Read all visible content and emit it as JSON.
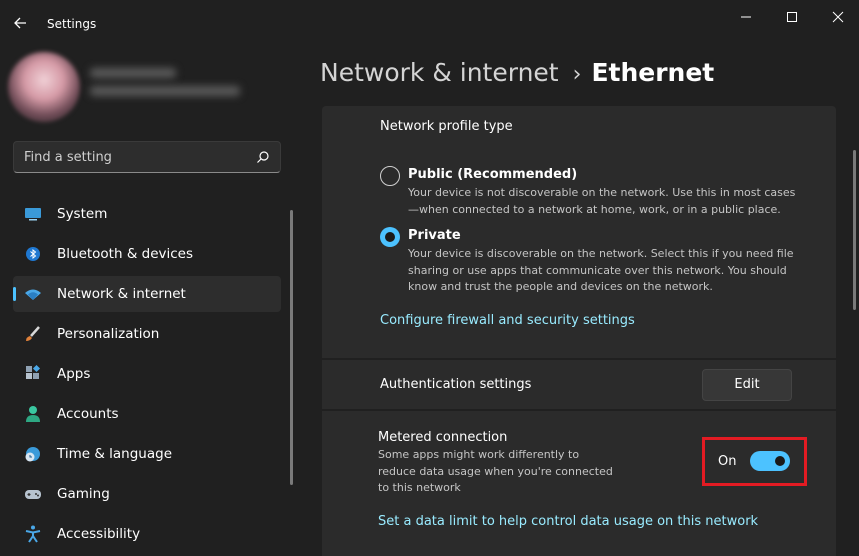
{
  "window": {
    "title": "Settings",
    "controls": [
      "minimize-icon",
      "maximize-icon",
      "close-icon"
    ]
  },
  "search": {
    "placeholder": "Find a setting"
  },
  "sidebar": {
    "items": [
      {
        "label": "System",
        "icon": "monitor-icon",
        "active": false
      },
      {
        "label": "Bluetooth & devices",
        "icon": "bluetooth-icon",
        "active": false
      },
      {
        "label": "Network & internet",
        "icon": "wifi-icon",
        "active": true
      },
      {
        "label": "Personalization",
        "icon": "brush-icon",
        "active": false
      },
      {
        "label": "Apps",
        "icon": "apps-icon",
        "active": false
      },
      {
        "label": "Accounts",
        "icon": "person-icon",
        "active": false
      },
      {
        "label": "Time & language",
        "icon": "globe-clock-icon",
        "active": false
      },
      {
        "label": "Gaming",
        "icon": "gamepad-icon",
        "active": false
      },
      {
        "label": "Accessibility",
        "icon": "accessibility-icon",
        "active": false
      }
    ]
  },
  "breadcrumb": {
    "parent": "Network & internet",
    "separator": "›",
    "current": "Ethernet"
  },
  "network_profile": {
    "title": "Network profile type",
    "options": [
      {
        "title": "Public (Recommended)",
        "description": "Your device is not discoverable on the network. Use this in most cases —when connected to a network at home, work, or in a public place.",
        "selected": false
      },
      {
        "title": "Private",
        "description": "Your device is discoverable on the network. Select this if you need file sharing or use apps that communicate over this network. You should know and trust the people and devices on the network.",
        "selected": true
      }
    ],
    "firewall_link": "Configure firewall and security settings"
  },
  "authentication": {
    "label": "Authentication settings",
    "button": "Edit"
  },
  "metered": {
    "title": "Metered connection",
    "description": "Some apps might work differently to reduce data usage when you're connected to this network",
    "toggle_label": "On",
    "toggle_on": true,
    "data_limit_link": "Set a data limit to help control data usage on this network"
  },
  "colors": {
    "accent": "#4cc2ff",
    "link": "#99ebff",
    "highlight": "#e31b23",
    "background": "#202020",
    "card": "#2b2b2b"
  }
}
